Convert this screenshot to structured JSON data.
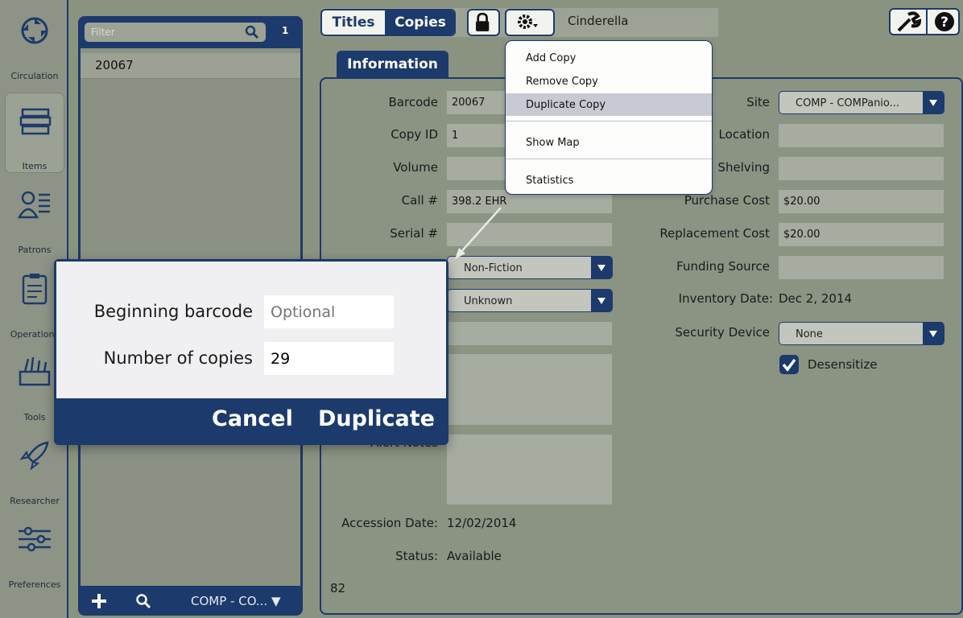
{
  "sidebar": {
    "items": [
      {
        "label": "Circulation",
        "icon": "circulation-icon"
      },
      {
        "label": "Items",
        "icon": "books-icon"
      },
      {
        "label": "Patrons",
        "icon": "patrons-icon"
      },
      {
        "label": "Operations",
        "icon": "clipboard-icon"
      },
      {
        "label": "Tools",
        "icon": "tools-icon"
      },
      {
        "label": "Researcher",
        "icon": "rocket-icon"
      },
      {
        "label": "Preferences",
        "icon": "sliders-icon"
      }
    ]
  },
  "list": {
    "filter_placeholder": "Filter",
    "count": "1",
    "rows": [
      "20067"
    ],
    "site_selector": "COMP - CO... ▼"
  },
  "tabs": {
    "titles": "Titles",
    "copies": "Copies"
  },
  "record_title": "Cinderella",
  "info_tab": "Information",
  "menu": {
    "items": [
      "Add Copy",
      "Remove Copy",
      "Duplicate Copy",
      "Show Map",
      "Statistics"
    ],
    "highlighted": "Duplicate Copy"
  },
  "form": {
    "barcode": {
      "label": "Barcode",
      "value": "20067"
    },
    "copy_id": {
      "label": "Copy ID",
      "value": "1"
    },
    "volume": {
      "label": "Volume",
      "value": ""
    },
    "call_number": {
      "label": "Call #",
      "value": "398.2 EHR"
    },
    "serial": {
      "label": "Serial #",
      "value": ""
    },
    "category_value": "Non-Fiction",
    "condition_value": "Unknown",
    "alert_notes_label": "Alert Notes",
    "accession_date": {
      "label": "Accession Date:",
      "value": "12/02/2014"
    },
    "status": {
      "label": "Status:",
      "value": "Available"
    },
    "footer_number": "82",
    "site": {
      "label": "Site",
      "value": "COMP - COMPanio..."
    },
    "location": {
      "label": "Location",
      "value": ""
    },
    "shelving": {
      "label": "Shelving",
      "value": ""
    },
    "purchase_cost": {
      "label": "Purchase Cost",
      "value": "$20.00"
    },
    "replacement_cost": {
      "label": "Replacement Cost",
      "value": "$20.00"
    },
    "funding_source": {
      "label": "Funding Source",
      "value": ""
    },
    "inventory_date": {
      "label": "Inventory Date:",
      "value": "Dec 2, 2014"
    },
    "security_device": {
      "label": "Security Device",
      "value": "None"
    },
    "desensitize": {
      "label": "Desensitize",
      "checked": true
    }
  },
  "dialog": {
    "beginning_barcode_label": "Beginning barcode",
    "beginning_barcode_placeholder": "Optional",
    "number_of_copies_label": "Number of copies",
    "number_of_copies_value": "29",
    "cancel": "Cancel",
    "duplicate": "Duplicate"
  },
  "colors": {
    "accent": "#1c3a6b",
    "background": "#8b9383"
  }
}
